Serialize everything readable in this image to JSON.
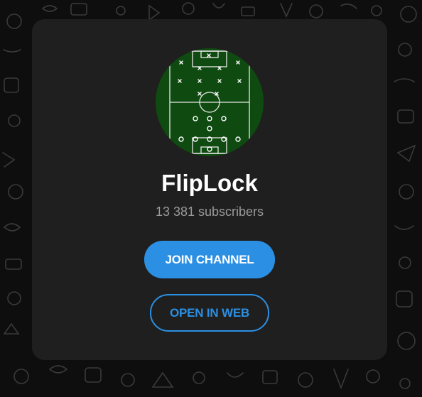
{
  "channel": {
    "name": "FlipLock",
    "subscribers": "13 381 subscribers"
  },
  "buttons": {
    "join_label": "JOIN CHANNEL",
    "open_label": "OPEN IN WEB"
  },
  "colors": {
    "background": "#0e0e0e",
    "card": "#1f1f1f",
    "accent": "#2b8fe3",
    "pitch": "#0f4a10",
    "title": "#ffffff",
    "subtitle": "#9a9a9a"
  },
  "icons": [
    "doodle-pattern",
    "football-pitch-formation"
  ]
}
